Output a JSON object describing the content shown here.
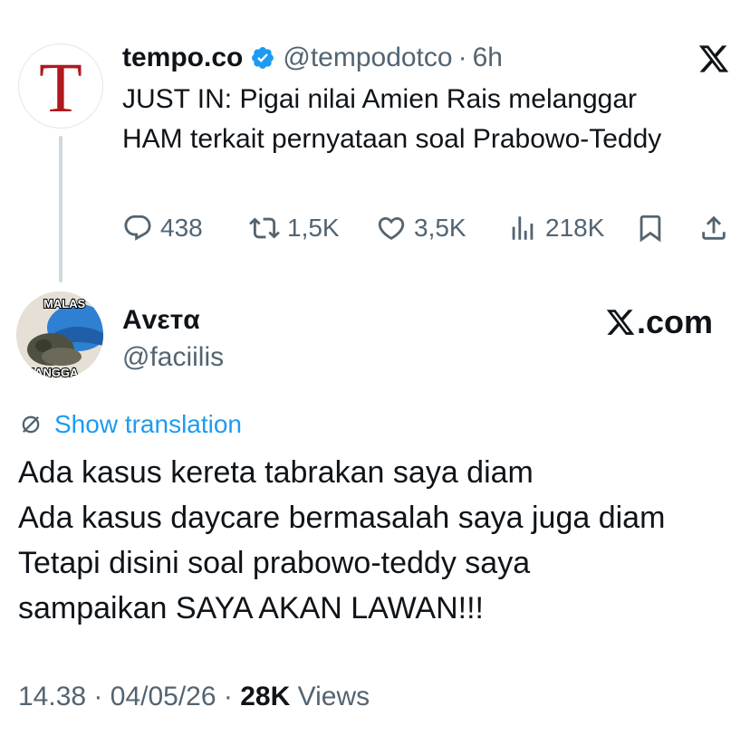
{
  "quoted_tweet": {
    "avatar_letter": "T",
    "name": "tempo.co",
    "handle": "@tempodotco",
    "separator": "·",
    "time": "6h",
    "text": "JUST IN: Pigai nilai Amien Rais melanggar HAM terkait pernyataan soal Prabowo-Teddy",
    "actions": {
      "replies": "438",
      "retweets": "1,5K",
      "likes": "3,5K",
      "views": "218K"
    }
  },
  "main_tweet": {
    "name": "Αvεтα",
    "handle": "@faciilis",
    "avatar_text_top": "MALAS",
    "avatar_text_bottom": "ENANGGA",
    "watermark": ".com",
    "translate_label": "Show translation",
    "text_lines": [
      "Ada kasus kereta tabrakan saya diam",
      "Ada kasus daycare bermasalah saya juga diam",
      "Tetapi disini soal prabowo-teddy saya",
      "sampaikan SAYA AKAN LAWAN!!!"
    ],
    "meta": {
      "time": "14.38",
      "separator": "·",
      "date": "04/05/26",
      "views_count": "28K",
      "views_label": "Views"
    }
  },
  "colors": {
    "tempo_red": "#b0191e",
    "link_blue": "#1d9bf0",
    "secondary_text": "#536471",
    "verified_blue": "#1d9bf0"
  }
}
